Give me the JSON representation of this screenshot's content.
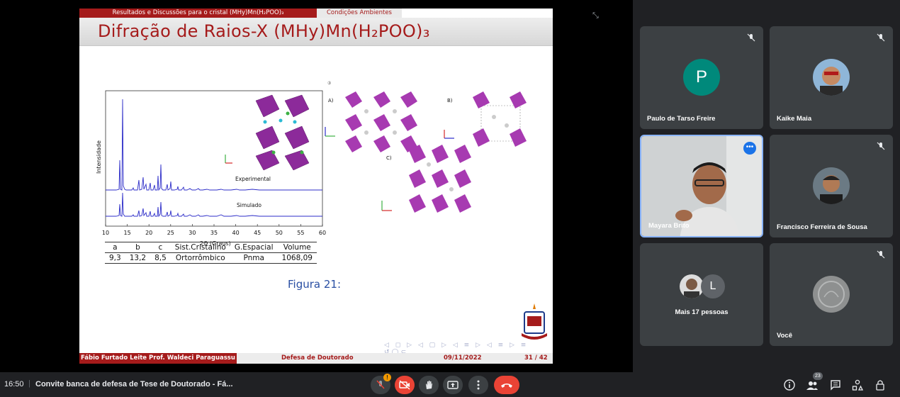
{
  "slide": {
    "section": "Resultados e Discussões para o cristal (MHy)Mn(H₂POO)₃",
    "subsection": "Condições Ambientes",
    "title": "Difração de Raios-X (MHy)Mn(H₂POO)₃",
    "figure_caption": "Figura 21:",
    "plot": {
      "ylabel": "Intensidade",
      "xlabel": "2Θ  (Graus)",
      "xticks": [
        "10",
        "15",
        "20",
        "25",
        "30",
        "35",
        "40",
        "45",
        "50",
        "55",
        "60"
      ],
      "series_experimental": "Experimental",
      "series_simulated": "Simulado"
    },
    "panel_labels": {
      "a": "A)",
      "b": "B)",
      "c": "C)"
    },
    "table": {
      "headers": [
        "a",
        "b",
        "c",
        "Sist.Cristalino",
        "G.Espacial",
        "Volume"
      ],
      "values": [
        "9,3",
        "13,2",
        "8,5",
        "Ortorrômbico",
        "Pnma",
        "1068,09"
      ]
    },
    "footer": {
      "authors": "Fábio Furtado Leite  Prof. Waldeci Paraguassu",
      "event": "Defesa de Doutorado",
      "date": "09/11/2022",
      "page": "31 / 42"
    }
  },
  "participants": [
    {
      "name": "Paulo de Tarso Freire",
      "initial": "P",
      "color": "#00897b"
    },
    {
      "name": "Kaike Maia"
    },
    {
      "name": "Mayara Brito"
    },
    {
      "name": "Francisco Ferreira de Sousa"
    },
    {
      "name": "Mais 17 pessoas",
      "initial": "L",
      "color": "#5f6368"
    },
    {
      "name": "Você"
    }
  ],
  "bottom_bar": {
    "time": "16:50",
    "meeting_title": "Convite banca de defesa de Tese de Doutorado - Fá...",
    "warning_badge": "!",
    "people_count": "23"
  }
}
